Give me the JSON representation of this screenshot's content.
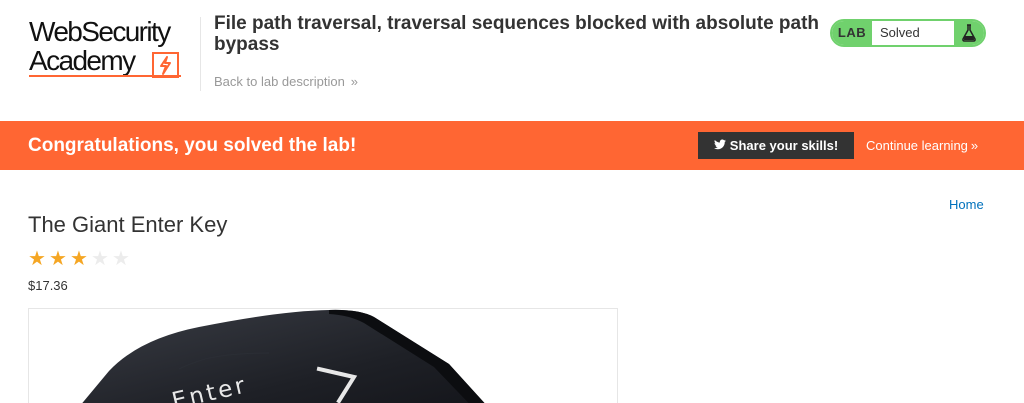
{
  "header": {
    "logo": {
      "line1": "WebSecurity",
      "line2": "Academy"
    },
    "title": "File path traversal, traversal sequences blocked with absolute path bypass",
    "back_link": {
      "label": "Back to lab description",
      "chevron": "»"
    },
    "lab_status": {
      "badge": "LAB",
      "state": "Solved",
      "icon": "flask-icon"
    }
  },
  "banner": {
    "message": "Congratulations, you solved the lab!",
    "share_label": "Share your skills!",
    "share_icon": "twitter-icon",
    "continue_label": "Continue learning",
    "continue_chevron": "»",
    "colors": {
      "banner": "#ff6633",
      "share_button": "#333333"
    }
  },
  "nav": {
    "home_label": "Home"
  },
  "product": {
    "title": "The Giant Enter Key",
    "rating": 3,
    "rating_max": 5,
    "price": "$17.36",
    "image": {
      "key_label": "Enter"
    }
  },
  "colors": {
    "accent": "#ff6633",
    "solved": "#70d16d",
    "link": "#0071bc"
  }
}
